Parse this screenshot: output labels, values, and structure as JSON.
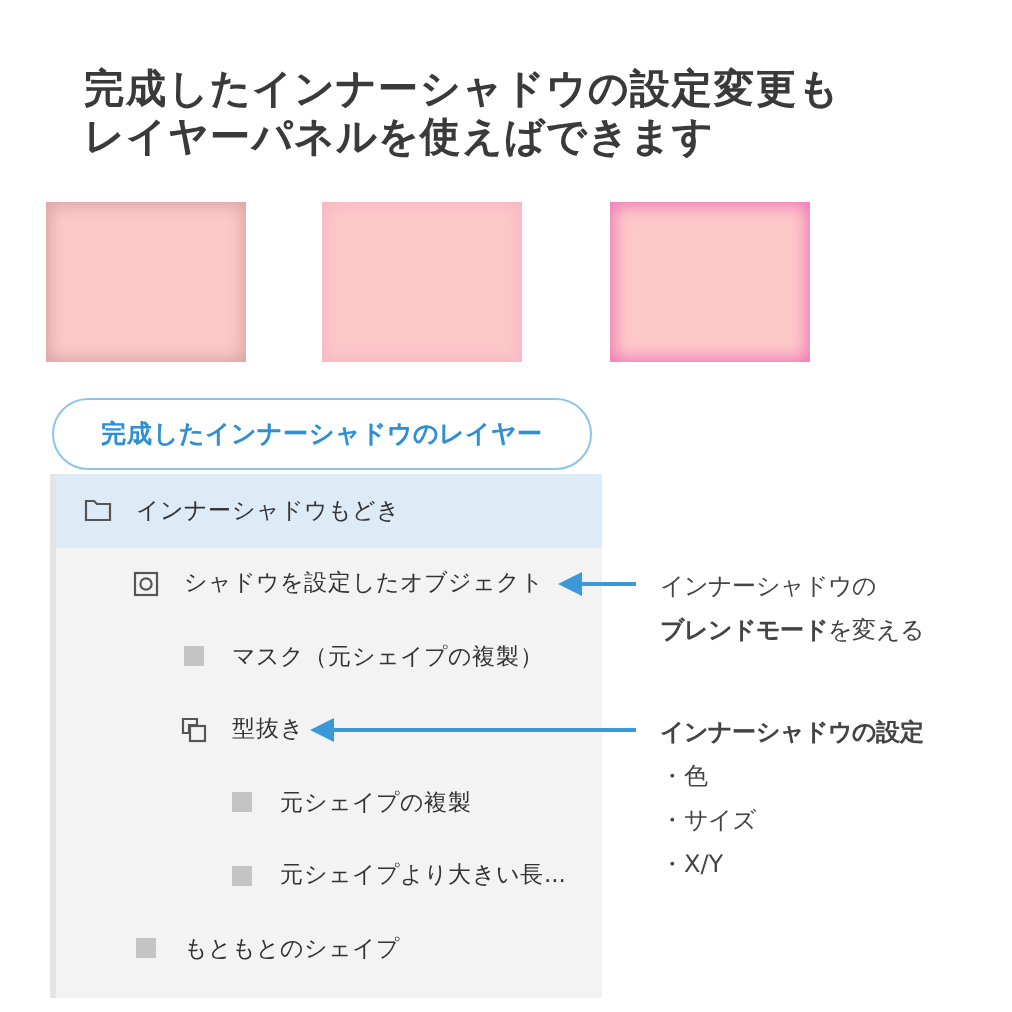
{
  "title_lines": [
    "完成したインナーシャドウの設定変更も",
    "レイヤーパネルを使えばできます"
  ],
  "swatches": [
    {
      "kind": "muted"
    },
    {
      "kind": "soft"
    },
    {
      "kind": "vivid"
    }
  ],
  "panel_label": "完成したインナーシャドウのレイヤー",
  "layers": [
    {
      "name": "インナーシャドウもどき",
      "kind": "folder",
      "selected": true,
      "children": [
        {
          "name": "シャドウを設定したオブジェクト",
          "kind": "target",
          "selected": false,
          "note": {
            "lines": [
              "インナーシャドウの",
              "**ブレンドモード**を変える"
            ]
          },
          "children": [
            {
              "name": "マスク（元シェイプの複製）",
              "kind": "shape",
              "selected": false
            },
            {
              "name": "型抜き",
              "kind": "pathfinder",
              "selected": false,
              "note": {
                "lines": [
                  "**インナーシャドウの設定**"
                ],
                "bullets": [
                  "・色",
                  "・サイズ",
                  "・X/Y"
                ]
              },
              "children": [
                {
                  "name": "元シェイプの複製",
                  "kind": "shape",
                  "selected": false
                },
                {
                  "name": "元シェイプより大きい長...",
                  "kind": "shape",
                  "selected": false
                }
              ]
            }
          ]
        },
        {
          "name": "もともとのシェイプ",
          "kind": "shape",
          "selected": false
        }
      ]
    }
  ]
}
